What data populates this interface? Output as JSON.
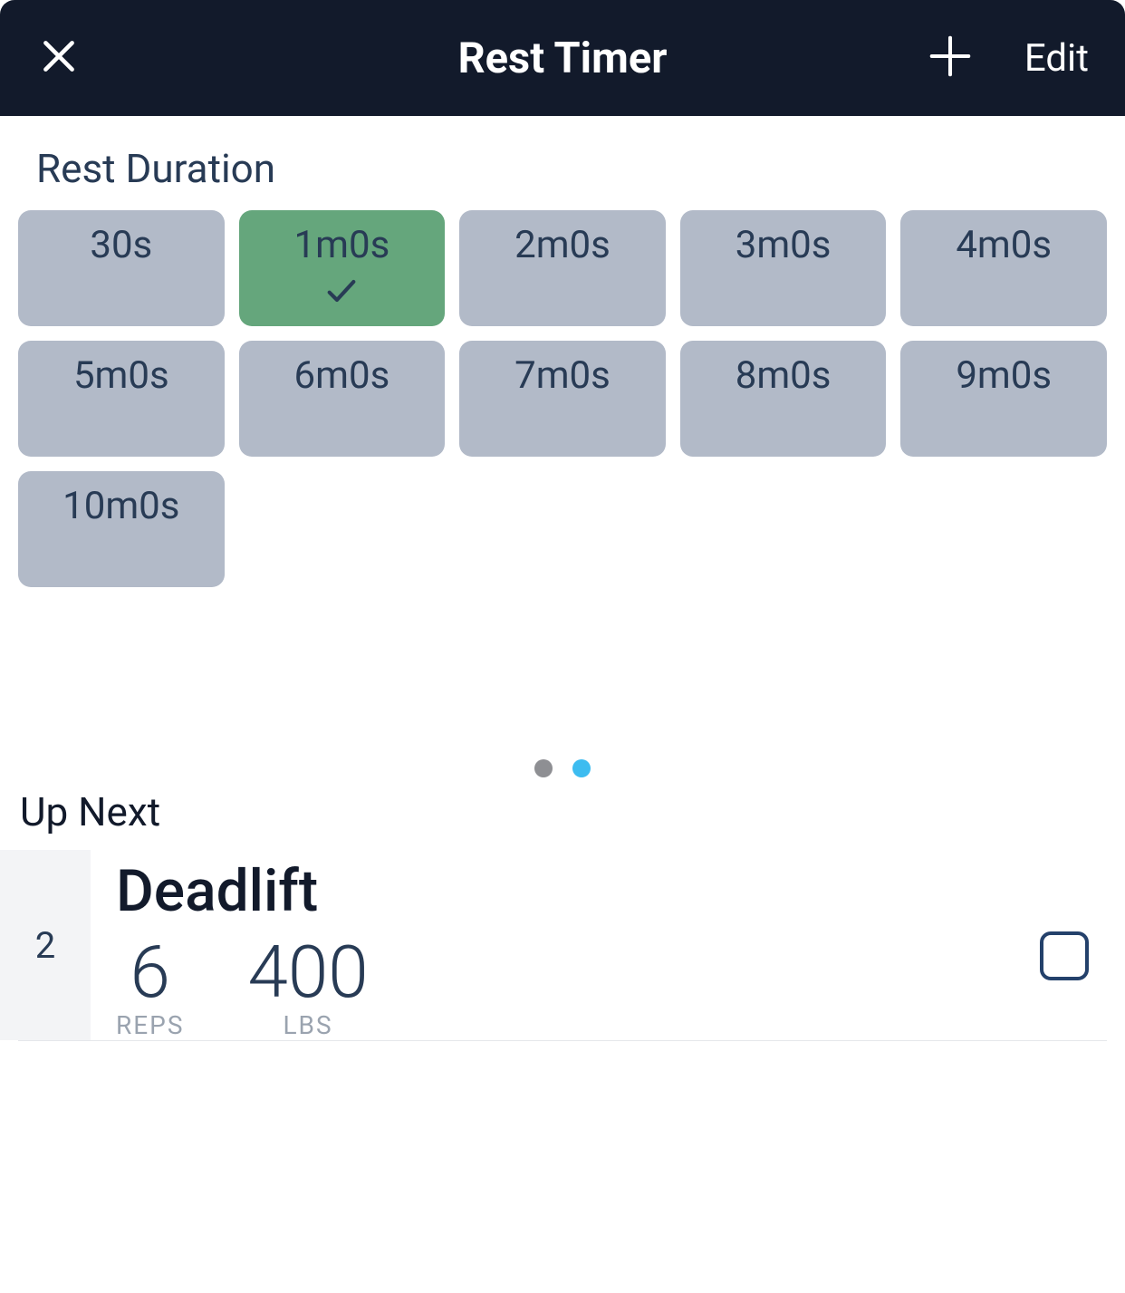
{
  "header": {
    "title": "Rest Timer",
    "edit_label": "Edit"
  },
  "rest_duration": {
    "section_label": "Rest Duration",
    "tiles": [
      {
        "label": "30s",
        "selected": false
      },
      {
        "label": "1m0s",
        "selected": true
      },
      {
        "label": "2m0s",
        "selected": false
      },
      {
        "label": "3m0s",
        "selected": false
      },
      {
        "label": "4m0s",
        "selected": false
      },
      {
        "label": "5m0s",
        "selected": false
      },
      {
        "label": "6m0s",
        "selected": false
      },
      {
        "label": "7m0s",
        "selected": false
      },
      {
        "label": "8m0s",
        "selected": false
      },
      {
        "label": "9m0s",
        "selected": false
      },
      {
        "label": "10m0s",
        "selected": false
      }
    ]
  },
  "up_next": {
    "section_label": "Up Next",
    "set_number": "2",
    "exercise_name": "Deadlift",
    "reps_value": "6",
    "reps_label": "REPS",
    "lbs_value": "400",
    "lbs_label": "LBS"
  }
}
